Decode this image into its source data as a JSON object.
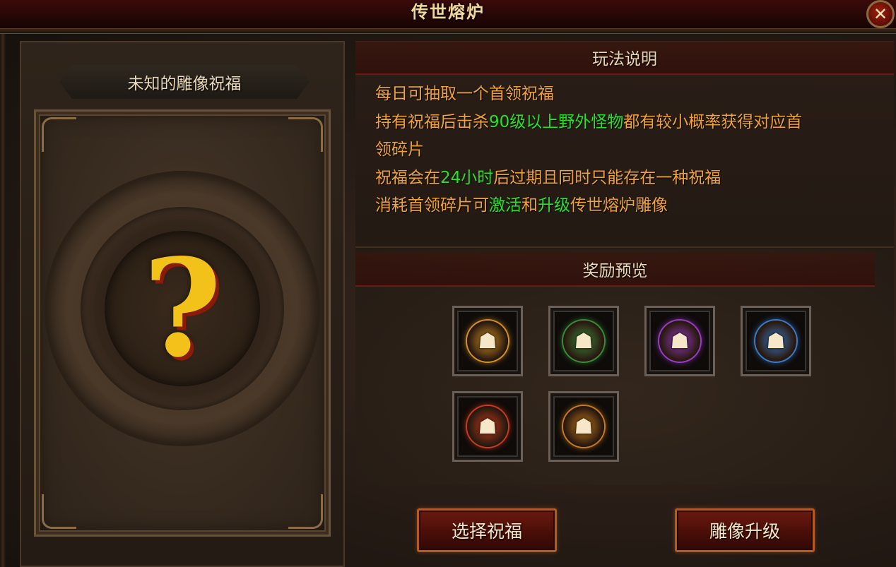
{
  "window": {
    "title": "传世熔炉",
    "close_label": "✕"
  },
  "left_panel": {
    "title": "未知的雕像祝福",
    "placeholder_glyph": "?"
  },
  "rules_section": {
    "header": "玩法说明",
    "lines": [
      [
        {
          "text": "每日可抽取一个首领祝福",
          "highlight": false
        }
      ],
      [
        {
          "text": "持有祝福后击杀",
          "highlight": false
        },
        {
          "text": "90级以上野外怪物",
          "highlight": true
        },
        {
          "text": "都有较小概率获得对应首",
          "highlight": false
        }
      ],
      [
        {
          "text": "领碎片",
          "highlight": false
        }
      ],
      [
        {
          "text": "祝福会在",
          "highlight": false
        },
        {
          "text": "24小时",
          "highlight": true
        },
        {
          "text": "后过期且同时只能存在一种祝福",
          "highlight": false
        }
      ],
      [
        {
          "text": "消耗首领碎片可",
          "highlight": false
        },
        {
          "text": "激活",
          "highlight": true
        },
        {
          "text": "和",
          "highlight": false
        },
        {
          "text": "升级",
          "highlight": true
        },
        {
          "text": "传世熔炉雕像",
          "highlight": false
        }
      ]
    ],
    "colors": {
      "normal": "#f0a23a",
      "highlight": "#27e327"
    }
  },
  "rewards_section": {
    "header": "奖励预览",
    "items": [
      {
        "icon": "boss-portrait-gold-icon",
        "glow": "#d49020"
      },
      {
        "icon": "boss-portrait-green-icon",
        "glow": "#3a8a3a"
      },
      {
        "icon": "boss-portrait-purple-icon",
        "glow": "#9a3ac8"
      },
      {
        "icon": "boss-portrait-blue-icon",
        "glow": "#3a7ac8"
      },
      {
        "icon": "boss-portrait-red-icon",
        "glow": "#c83a1a"
      },
      {
        "icon": "boss-portrait-orange-icon",
        "glow": "#c87a1a"
      }
    ]
  },
  "actions": {
    "choose_blessing": "选择祝福",
    "upgrade_statue": "雕像升级"
  }
}
